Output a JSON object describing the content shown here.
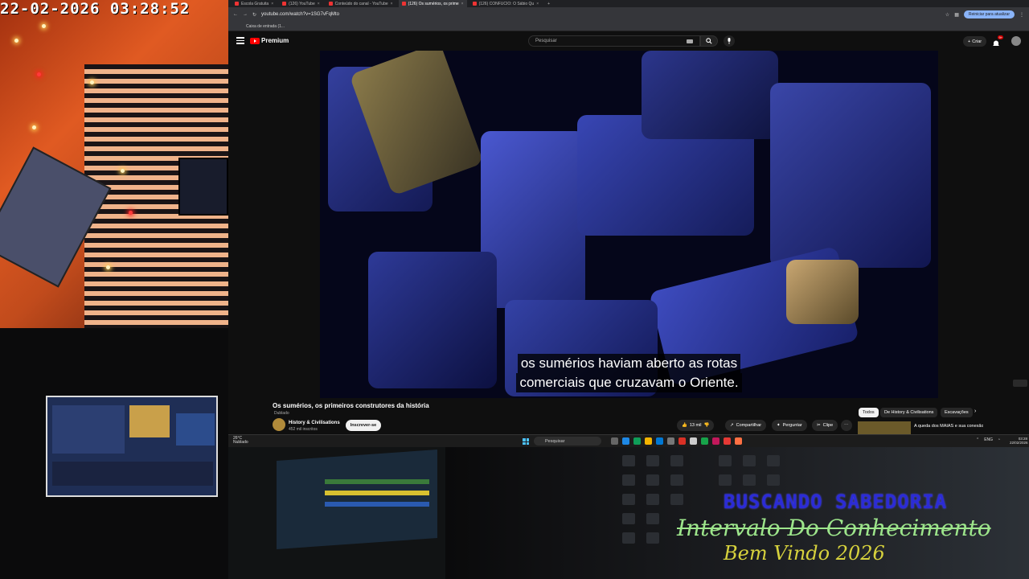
{
  "overlay": {
    "clock": "22-02-2026 03:28:52",
    "brand_top": "BUSCANDO SABEDORIA",
    "brand_middle": "Intervalo Do Conhecimento",
    "brand_bottom": "Bem Vindo 2026"
  },
  "browser": {
    "tabs": [
      {
        "label": "Escola Gratuita"
      },
      {
        "label": "(126) YouTube"
      },
      {
        "label": "Conteúdo do canal - YouTube"
      },
      {
        "label": "(126) Os sumérios, os prime"
      },
      {
        "label": "(126) CONFUCIO: O Sábio Qu"
      }
    ],
    "url": "youtube.com/watch?v=1SG7vFqMto",
    "reload_button": "Reiniciar para atualizar",
    "bookmark": "Caixa de entrada (1..."
  },
  "youtube": {
    "logo": "Premium",
    "search_placeholder": "Pesquisar",
    "create_label": "Criar",
    "notif_count": "9+",
    "video": {
      "subtitle_line1": "os sumérios haviam aberto as rotas",
      "subtitle_line2": "comerciais que cruzavam o Oriente.",
      "title": "Os sumérios, os primeiros construtores da história",
      "dubbed": "Dublado",
      "channel": "History & Civilisations",
      "subscribers": "452 mil inscritos",
      "subscribe_label": "Inscrever-se",
      "likes": "13 mil",
      "share": "Compartilhar",
      "ask": "Perguntar",
      "clip": "Clipe"
    },
    "chips": [
      "Todos",
      "De History & Civilisations",
      "Escavações"
    ],
    "recommendation": "A queda dos MAIAS e sua conexão moderna com o"
  },
  "taskbar": {
    "weather_temp": "26°C",
    "weather_desc": "Nublado",
    "search_placeholder": "Pesquisar",
    "lang": "ENG",
    "time": "03:28",
    "date": "22/02/2026"
  }
}
